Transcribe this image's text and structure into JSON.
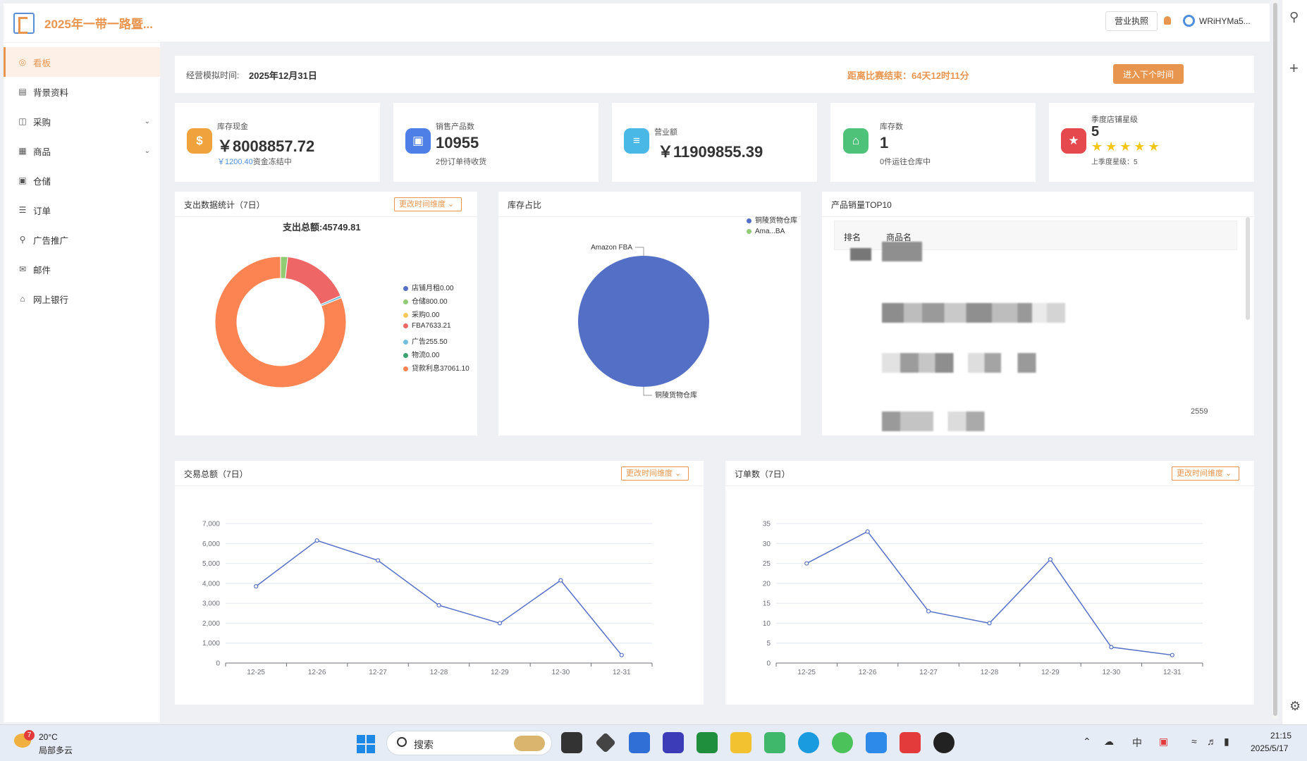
{
  "app": {
    "title": "2025年一带一路暨..."
  },
  "sidebar": {
    "items": [
      {
        "label": "看板",
        "icon": "dashboard-icon",
        "glyph": "◎"
      },
      {
        "label": "背景资料",
        "icon": "document-icon",
        "glyph": "▤"
      },
      {
        "label": "采购",
        "icon": "bag-icon",
        "glyph": "◫"
      },
      {
        "label": "商品",
        "icon": "grid-icon",
        "glyph": "▦"
      },
      {
        "label": "仓储",
        "icon": "warehouse-icon",
        "glyph": "▣"
      },
      {
        "label": "订单",
        "icon": "list-icon",
        "glyph": "☰"
      },
      {
        "label": "广告推广",
        "icon": "location-icon",
        "glyph": "⚲"
      },
      {
        "label": "邮件",
        "icon": "mail-icon",
        "glyph": "✉"
      },
      {
        "label": "网上银行",
        "icon": "bank-icon",
        "glyph": "⌂"
      }
    ]
  },
  "topbar": {
    "license_btn": "营业执照",
    "username": "WRiHYMa5..."
  },
  "sim": {
    "label": "经营模拟时间:",
    "value": "2025年12月31日",
    "countdown": "距离比赛结束：64天12时11分",
    "next_btn": "进入下个时间"
  },
  "stats": {
    "cash": {
      "label": "库存现金",
      "value": "￥8008857.72",
      "sub_amount": "￥1200.40",
      "sub_text": "资金冻结中"
    },
    "sold": {
      "label": "销售产品数",
      "value": "10955",
      "sub": "2份订单待收货"
    },
    "revenue": {
      "label": "营业额",
      "value": "￥11909855.39"
    },
    "inventory": {
      "label": "库存数",
      "value": "1",
      "sub": "0件运往仓库中"
    },
    "rating": {
      "label": "季度店铺星级",
      "value": "5",
      "stars": "★★★★★",
      "sub": "上季度星级：5"
    }
  },
  "expense": {
    "title": "支出数据统计（7日）",
    "dim_btn": "更改时间维度 ⌄",
    "total": "支出总额:45749.81"
  },
  "inventory_ratio": {
    "title": "库存占比"
  },
  "top10": {
    "title": "产品销量TOP10",
    "col_rank": "排名",
    "col_product": "商品名",
    "visible_value": "2559"
  },
  "trade": {
    "title": "交易总额（7日）",
    "dim_btn": "更改时间维度 ⌄"
  },
  "orders": {
    "title": "订单数（7日）",
    "dim_btn": "更改时间维度 ⌄"
  },
  "chart_data": [
    {
      "type": "pie",
      "variant": "donut",
      "title": "支出总额:45749.81",
      "slices": [
        {
          "label": "店铺月租",
          "value": 0.0,
          "legend": "店铺月租0.00",
          "color": "#5470c6"
        },
        {
          "label": "仓储",
          "value": 800.0,
          "legend": "仓储800.00",
          "color": "#91cc75"
        },
        {
          "label": "采购",
          "value": 0.0,
          "legend": "采购0.00",
          "color": "#fac858"
        },
        {
          "label": "FBA",
          "value": 7633.21,
          "legend": "FBA7633.21",
          "color": "#ee6666"
        },
        {
          "label": "广告",
          "value": 255.5,
          "legend": "广告255.50",
          "color": "#73c0de"
        },
        {
          "label": "物流",
          "value": 0.0,
          "legend": "物流0.00",
          "color": "#3ba272"
        },
        {
          "label": "贷款利息",
          "value": 37061.1,
          "legend": "贷款利息37061.10",
          "color": "#fc8452"
        }
      ],
      "legend_position": "right"
    },
    {
      "type": "pie",
      "slices": [
        {
          "label": "铜陵货物仓库",
          "legend": "铜陵货物仓库",
          "value": 1,
          "color": "#5470c6"
        },
        {
          "label": "Amazon FBA",
          "legend": "Ama...BA",
          "value": 0,
          "color": "#91cc75"
        }
      ],
      "legend_position": "top-right"
    },
    {
      "type": "line",
      "title": "交易总额（7日）",
      "categories": [
        "12-25",
        "12-26",
        "12-27",
        "12-28",
        "12-29",
        "12-30",
        "12-31"
      ],
      "series": [
        {
          "values": [
            3850,
            6150,
            5150,
            2900,
            2000,
            4150,
            400
          ]
        }
      ],
      "ylim": [
        0,
        7000
      ],
      "yticks": [
        0,
        1000,
        2000,
        3000,
        4000,
        5000,
        6000,
        7000
      ],
      "ytick_labels": [
        "0",
        "1,000",
        "2,000",
        "3,000",
        "4,000",
        "5,000",
        "6,000",
        "7,000"
      ],
      "color": "#5470c6",
      "grid": true
    },
    {
      "type": "line",
      "title": "订单数（7日）",
      "categories": [
        "12-25",
        "12-26",
        "12-27",
        "12-28",
        "12-29",
        "12-30",
        "12-31"
      ],
      "series": [
        {
          "values": [
            25,
            33,
            13,
            10,
            26,
            4,
            2
          ]
        }
      ],
      "ylim": [
        0,
        35
      ],
      "yticks": [
        0,
        5,
        10,
        15,
        20,
        25,
        30,
        35
      ],
      "ytick_labels": [
        "0",
        "5",
        "10",
        "15",
        "20",
        "25",
        "30",
        "35"
      ],
      "color": "#5470c6",
      "grid": true
    }
  ],
  "taskbar": {
    "weather_temp": "20°C",
    "weather_desc": "局部多云",
    "weather_badge": "7",
    "search": "搜索",
    "time": "21:15",
    "date": "2025/5/17",
    "ime": "中"
  }
}
